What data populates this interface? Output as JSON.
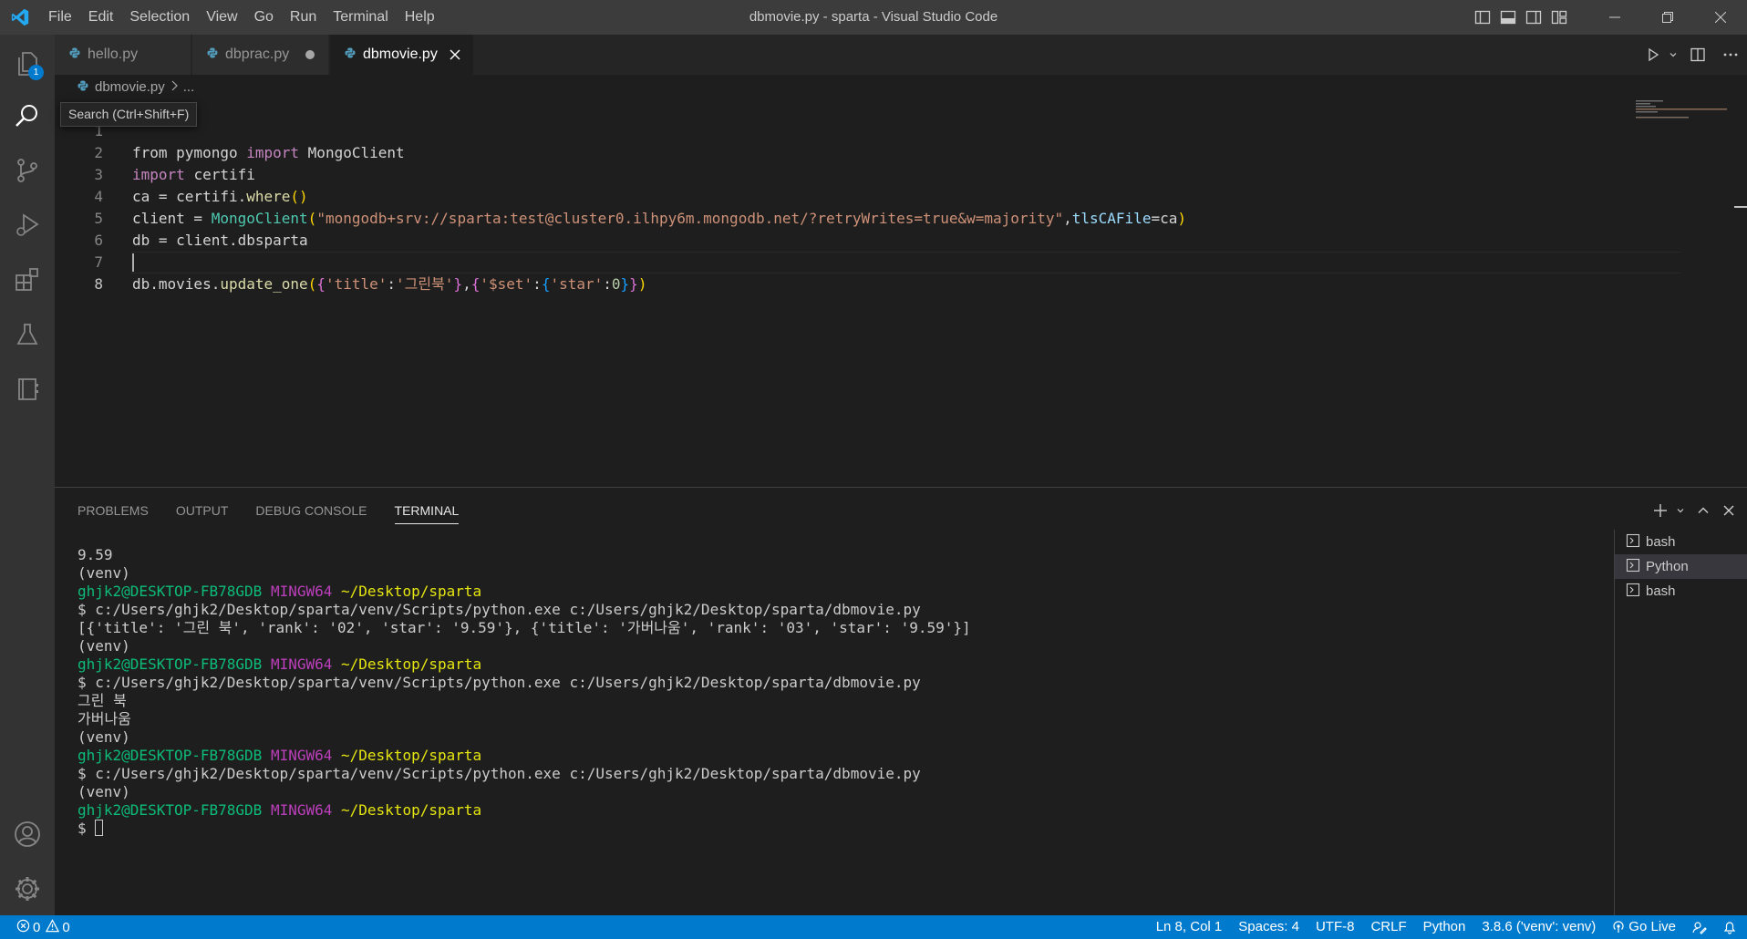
{
  "window": {
    "title": "dbmovie.py - sparta - Visual Studio Code",
    "menu": [
      "File",
      "Edit",
      "Selection",
      "View",
      "Go",
      "Run",
      "Terminal",
      "Help"
    ]
  },
  "activity": {
    "explorer_badge": "1",
    "tooltip": "Search (Ctrl+Shift+F)"
  },
  "tabs": [
    {
      "label": "hello.py",
      "state": "inactive"
    },
    {
      "label": "dbprac.py",
      "state": "modified"
    },
    {
      "label": "dbmovie.py",
      "state": "active"
    }
  ],
  "breadcrumb": {
    "file": "dbmovie.py",
    "more": "..."
  },
  "editor": {
    "line_numbers": [
      "1",
      "2",
      "3",
      "4",
      "5",
      "6",
      "7",
      "8"
    ],
    "line1": {
      "a": "from pymongo",
      "b": "import",
      "c": "MongoClient"
    },
    "line2": {
      "a": "import",
      "b": "certifi"
    },
    "line3": {
      "a": "ca = certifi.",
      "b": "where",
      "c": "()"
    },
    "line4": {
      "a": "client = ",
      "b": "MongoClient",
      "c": "(",
      "d": "\"mongodb+srv://sparta:test@cluster0.ilhpy6m.mongodb.net/?retryWrites=true&w=majority\"",
      "e": ",",
      "f": "tlsCAFile",
      "g": "=ca",
      "h": ")"
    },
    "line5": {
      "a": "db = client.dbsparta"
    },
    "line7": {
      "a": "db.movies.",
      "b": "update_one",
      "c": "(",
      "d": "{",
      "e": "'title'",
      "f": ":",
      "g": "'그린북'",
      "h": "}",
      "i": ",",
      "j": "{",
      "k": "'$set'",
      "l": ":",
      "m": "{",
      "n": "'star'",
      "o": ":",
      "p": "0",
      "q": "}",
      "r": "}",
      "s": ")"
    }
  },
  "panel": {
    "tabs": [
      "PROBLEMS",
      "OUTPUT",
      "DEBUG CONSOLE",
      "TERMINAL"
    ],
    "terminal": {
      "l1": "9.59",
      "l2": "(venv)",
      "user": "ghjk2@DESKTOP-FB78GDB",
      "env": "MINGW64",
      "path": "~/Desktop/sparta",
      "cmd": "$ c:/Users/ghjk2/Desktop/sparta/venv/Scripts/python.exe c:/Users/ghjk2/Desktop/sparta/dbmovie.py",
      "l5": "[{'title': '그린 북', 'rank': '02', 'star': '9.59'}, {'title': '가버나움', 'rank': '03', 'star': '9.59'}]",
      "l9": "그린 북",
      "l10": "가버나움",
      "prompt": "$ "
    },
    "instances": [
      "bash",
      "Python",
      "bash"
    ]
  },
  "status": {
    "errors": "0",
    "warnings": "0",
    "position": "Ln 8, Col 1",
    "spaces": "Spaces: 4",
    "encoding": "UTF-8",
    "eol": "CRLF",
    "language": "Python",
    "interpreter": "3.8.6 ('venv': venv)",
    "live": "Go Live"
  },
  "colors": {
    "accent": "#007acc",
    "titlebar": "#3c3c3c",
    "activitybar": "#333333",
    "editor": "#1e1e1e"
  },
  "icons": [
    "vscode-logo",
    "files-icon",
    "search-icon",
    "source-control-icon",
    "run-debug-icon",
    "extensions-icon",
    "testing-icon",
    "notebook-icon",
    "account-icon",
    "gear-icon",
    "python-file-icon",
    "run-icon",
    "split-editor-icon",
    "more-icon",
    "plus-icon",
    "chevron-up-icon",
    "close-icon",
    "terminal-icon",
    "error-icon",
    "warning-icon",
    "broadcast-icon",
    "feedback-icon",
    "bell-icon"
  ]
}
